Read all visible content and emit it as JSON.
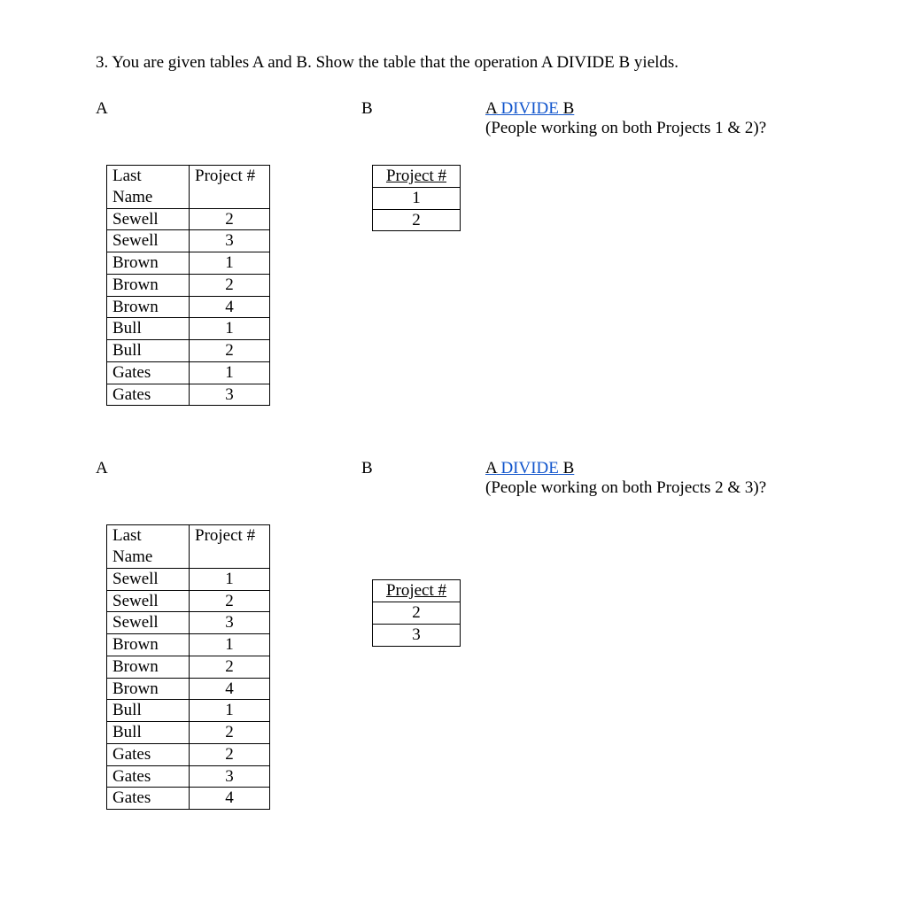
{
  "question": "3. You are given tables A and B. Show the table that the operation A DIVIDE B yields.",
  "labels": {
    "A": "A",
    "B": "B",
    "adivb_a": "A",
    "adivb_mid": " DIVIDE",
    "adivb_b": " B"
  },
  "section1": {
    "subnote": "(People working on both Projects 1 & 2)?",
    "tableA": {
      "headers": [
        "Last Name",
        "Project #"
      ],
      "rows": [
        [
          "Sewell",
          "2"
        ],
        [
          "Sewell",
          "3"
        ],
        [
          "Brown",
          "1"
        ],
        [
          "Brown",
          "2"
        ],
        [
          "Brown",
          "4"
        ],
        [
          "Bull",
          "1"
        ],
        [
          "Bull",
          "2"
        ],
        [
          "Gates",
          "1"
        ],
        [
          "Gates",
          "3"
        ]
      ]
    },
    "tableB": {
      "header": "Project #",
      "rows": [
        "1",
        "2"
      ]
    }
  },
  "section2": {
    "subnote": "(People working on both Projects 2 & 3)?",
    "tableA": {
      "headers": [
        "Last Name",
        "Project #"
      ],
      "rows": [
        [
          "Sewell",
          "1"
        ],
        [
          "Sewell",
          "2"
        ],
        [
          "Sewell",
          "3"
        ],
        [
          "Brown",
          "1"
        ],
        [
          "Brown",
          "2"
        ],
        [
          "Brown",
          "4"
        ],
        [
          "Bull",
          "1"
        ],
        [
          "Bull",
          "2"
        ],
        [
          "Gates",
          "2"
        ],
        [
          "Gates",
          "3"
        ],
        [
          "Gates",
          "4"
        ]
      ]
    },
    "tableB": {
      "header": "Project #",
      "rows": [
        "2",
        "3"
      ]
    }
  },
  "chart_data": [
    {
      "type": "table",
      "name": "A (section 1)",
      "columns": [
        "Last Name",
        "Project #"
      ],
      "rows": [
        [
          "Sewell",
          2
        ],
        [
          "Sewell",
          3
        ],
        [
          "Brown",
          1
        ],
        [
          "Brown",
          2
        ],
        [
          "Brown",
          4
        ],
        [
          "Bull",
          1
        ],
        [
          "Bull",
          2
        ],
        [
          "Gates",
          1
        ],
        [
          "Gates",
          3
        ]
      ]
    },
    {
      "type": "table",
      "name": "B (section 1)",
      "columns": [
        "Project #"
      ],
      "rows": [
        [
          1
        ],
        [
          2
        ]
      ]
    },
    {
      "type": "table",
      "name": "A (section 2)",
      "columns": [
        "Last Name",
        "Project #"
      ],
      "rows": [
        [
          "Sewell",
          1
        ],
        [
          "Sewell",
          2
        ],
        [
          "Sewell",
          3
        ],
        [
          "Brown",
          1
        ],
        [
          "Brown",
          2
        ],
        [
          "Brown",
          4
        ],
        [
          "Bull",
          1
        ],
        [
          "Bull",
          2
        ],
        [
          "Gates",
          2
        ],
        [
          "Gates",
          3
        ],
        [
          "Gates",
          4
        ]
      ]
    },
    {
      "type": "table",
      "name": "B (section 2)",
      "columns": [
        "Project #"
      ],
      "rows": [
        [
          2
        ],
        [
          3
        ]
      ]
    }
  ]
}
